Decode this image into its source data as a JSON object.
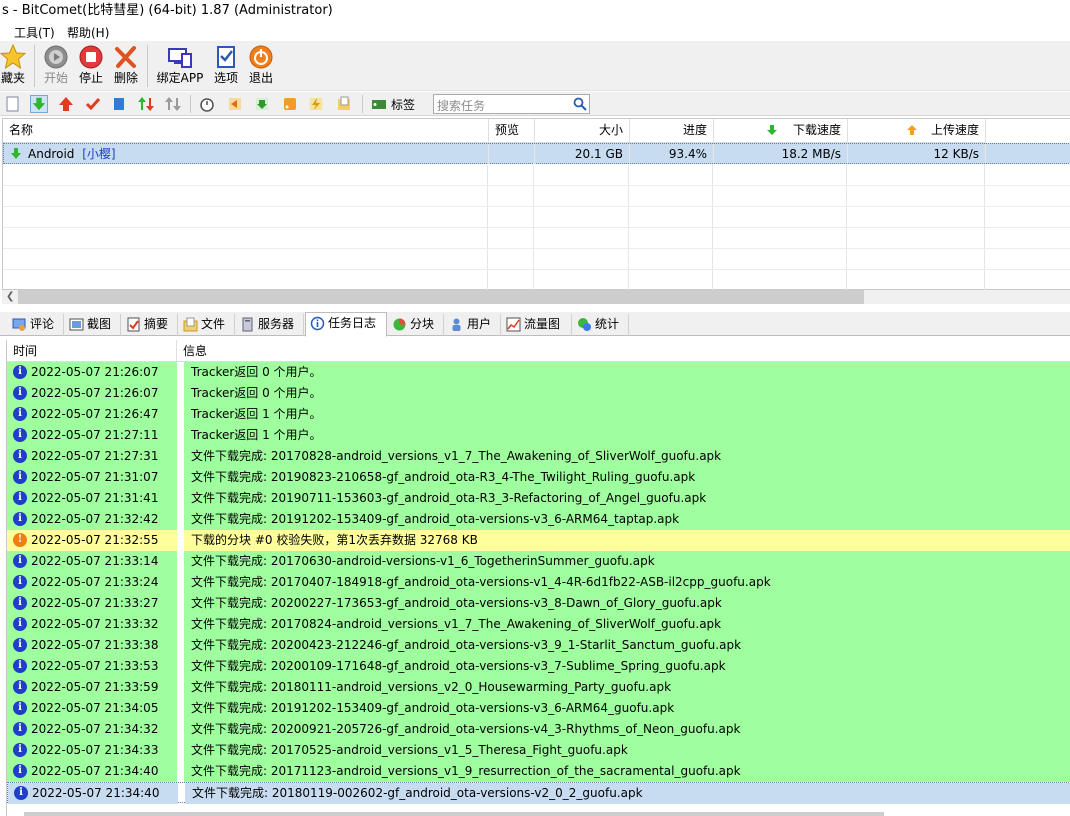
{
  "window": {
    "title": "s - BitComet(比特彗星) (64-bit) 1.87 (Administrator)"
  },
  "menu": [
    {
      "label": "工具(T)"
    },
    {
      "label": "帮助(H)"
    }
  ],
  "toolbar": {
    "buttons": [
      {
        "label": "藏夹",
        "icon": "star-icon",
        "enabled": true
      },
      {
        "label": "开始",
        "icon": "start-icon",
        "enabled": false
      },
      {
        "label": "停止",
        "icon": "stop-icon",
        "enabled": true
      },
      {
        "label": "删除",
        "icon": "delete-icon",
        "enabled": true
      },
      {
        "label": "绑定APP",
        "icon": "bind-app-icon",
        "enabled": true
      },
      {
        "label": "选项",
        "icon": "options-icon",
        "enabled": true
      },
      {
        "label": "退出",
        "icon": "exit-icon",
        "enabled": true
      }
    ]
  },
  "toolbar2": {
    "tags_label": "标签",
    "search_placeholder": "搜索任务"
  },
  "task_table": {
    "columns": [
      "名称",
      "预览",
      "大小",
      "进度",
      "下载速度",
      "上传速度"
    ],
    "rows": [
      {
        "name": "Android",
        "tag": "[小樱]",
        "preview": "",
        "size": "20.1 GB",
        "progress": "93.4%",
        "down": "18.2 MB/s",
        "up": "12 KB/s"
      }
    ]
  },
  "tabs": [
    {
      "label": "评论",
      "icon": "comment-icon"
    },
    {
      "label": "截图",
      "icon": "screenshot-icon"
    },
    {
      "label": "摘要",
      "icon": "summary-icon"
    },
    {
      "label": "文件",
      "icon": "file-icon"
    },
    {
      "label": "服务器",
      "icon": "server-icon"
    },
    {
      "label": "任务日志",
      "icon": "log-icon",
      "active": true
    },
    {
      "label": "分块",
      "icon": "pieces-icon"
    },
    {
      "label": "用户",
      "icon": "user-icon"
    },
    {
      "label": "流量图",
      "icon": "traffic-chart-icon"
    },
    {
      "label": "统计",
      "icon": "statistics-icon"
    }
  ],
  "log": {
    "columns": [
      "时间",
      "信息"
    ],
    "colors": {
      "green": "#9ffe9e",
      "yellow": "#fffe9b",
      "blue": "#c7dcf1"
    },
    "rows": [
      {
        "time": "2022-05-07 21:26:07",
        "msg": "Tracker返回 0 个用户。",
        "type": "info",
        "color": "green"
      },
      {
        "time": "2022-05-07 21:26:07",
        "msg": "Tracker返回 0 个用户。",
        "type": "info",
        "color": "green"
      },
      {
        "time": "2022-05-07 21:26:47",
        "msg": "Tracker返回 1 个用户。",
        "type": "info",
        "color": "green"
      },
      {
        "time": "2022-05-07 21:27:11",
        "msg": "Tracker返回 1 个用户。",
        "type": "info",
        "color": "green"
      },
      {
        "time": "2022-05-07 21:27:31",
        "msg": "文件下载完成: 20170828-android_versions_v1_7_The_Awakening_of_SliverWolf_guofu.apk",
        "type": "info",
        "color": "green"
      },
      {
        "time": "2022-05-07 21:31:07",
        "msg": "文件下载完成: 20190823-210658-gf_android_ota-R3_4-The_Twilight_Ruling_guofu.apk",
        "type": "info",
        "color": "green"
      },
      {
        "time": "2022-05-07 21:31:41",
        "msg": "文件下载完成: 20190711-153603-gf_android_ota-R3_3-Refactoring_of_Angel_guofu.apk",
        "type": "info",
        "color": "green"
      },
      {
        "time": "2022-05-07 21:32:42",
        "msg": "文件下载完成: 20191202-153409-gf_android_ota-versions-v3_6-ARM64_taptap.apk",
        "type": "info",
        "color": "green"
      },
      {
        "time": "2022-05-07 21:32:55",
        "msg": "下载的分块 #0 校验失败，第1次丢弃数据 32768 KB",
        "type": "warn",
        "color": "yellow"
      },
      {
        "time": "2022-05-07 21:33:14",
        "msg": "文件下载完成: 20170630-android-versions-v1_6_TogetherinSummer_guofu.apk",
        "type": "info",
        "color": "green"
      },
      {
        "time": "2022-05-07 21:33:24",
        "msg": "文件下载完成: 20170407-184918-gf_android_ota-versions-v1_4-4R-6d1fb22-ASB-il2cpp_guofu.apk",
        "type": "info",
        "color": "green"
      },
      {
        "time": "2022-05-07 21:33:27",
        "msg": "文件下载完成: 20200227-173653-gf_android_ota-versions-v3_8-Dawn_of_Glory_guofu.apk",
        "type": "info",
        "color": "green"
      },
      {
        "time": "2022-05-07 21:33:32",
        "msg": "文件下载完成: 20170824-android_versions_v1_7_The_Awakening_of_SliverWolf_guofu.apk",
        "type": "info",
        "color": "green"
      },
      {
        "time": "2022-05-07 21:33:38",
        "msg": "文件下载完成: 20200423-212246-gf_android_ota-versions-v3_9_1-Starlit_Sanctum_guofu.apk",
        "type": "info",
        "color": "green"
      },
      {
        "time": "2022-05-07 21:33:53",
        "msg": "文件下载完成: 20200109-171648-gf_android_ota-versions-v3_7-Sublime_Spring_guofu.apk",
        "type": "info",
        "color": "green"
      },
      {
        "time": "2022-05-07 21:33:59",
        "msg": "文件下载完成: 20180111-android_versions_v2_0_Housewarming_Party_guofu.apk",
        "type": "info",
        "color": "green"
      },
      {
        "time": "2022-05-07 21:34:05",
        "msg": "文件下载完成: 20191202-153409-gf_android_ota-versions-v3_6-ARM64_guofu.apk",
        "type": "info",
        "color": "green"
      },
      {
        "time": "2022-05-07 21:34:32",
        "msg": "文件下载完成: 20200921-205726-gf_android_ota-versions-v4_3-Rhythms_of_Neon_guofu.apk",
        "type": "info",
        "color": "green"
      },
      {
        "time": "2022-05-07 21:34:33",
        "msg": "文件下载完成: 20170525-android_versions_v1_5_Theresa_Fight_guofu.apk",
        "type": "info",
        "color": "green"
      },
      {
        "time": "2022-05-07 21:34:40",
        "msg": "文件下载完成: 20171123-android_versions_v1_9_resurrection_of_the_sacramental_guofu.apk",
        "type": "info",
        "color": "green"
      },
      {
        "time": "2022-05-07 21:34:40",
        "msg": "文件下载完成: 20180119-002602-gf_android_ota-versions-v2_0_2_guofu.apk",
        "type": "info",
        "color": "blue"
      }
    ]
  }
}
